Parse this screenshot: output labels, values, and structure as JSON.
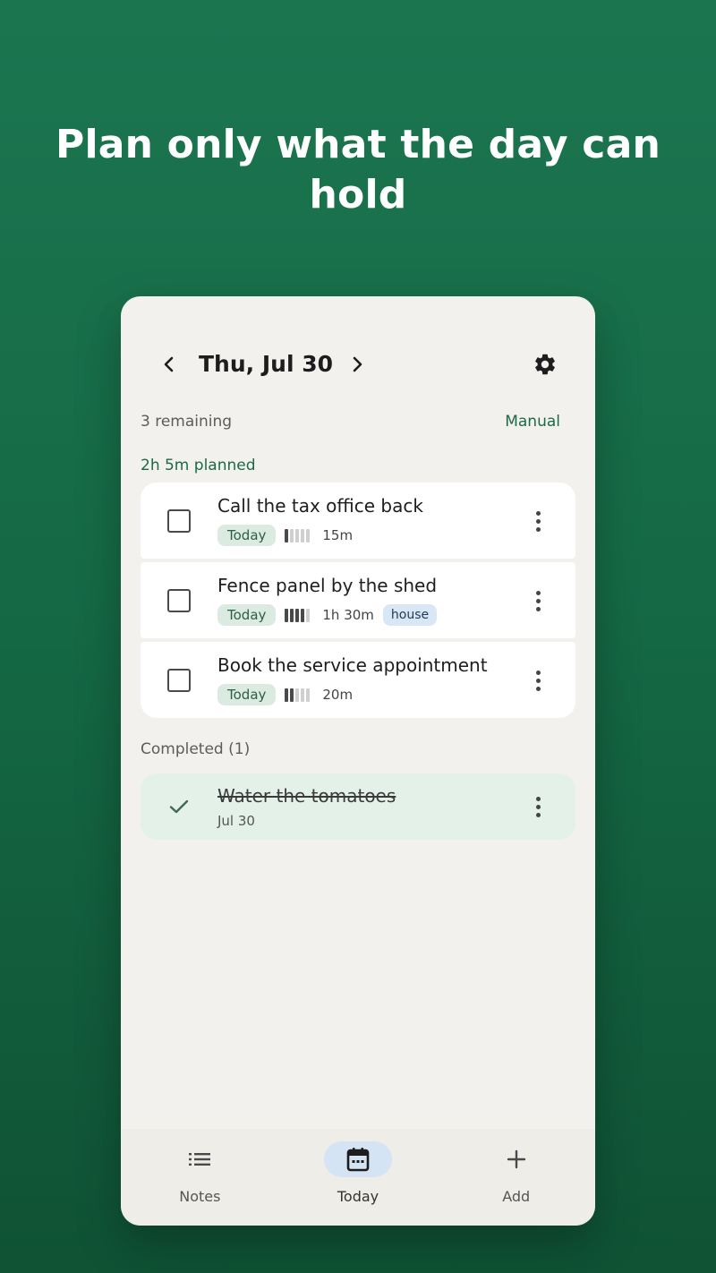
{
  "headline": "Plan only what the day can hold",
  "header": {
    "date": "Thu, Jul 30",
    "prev_icon": "chevron-left-icon",
    "next_icon": "chevron-right-icon",
    "settings_icon": "gear-icon"
  },
  "summary": {
    "remaining": "3 remaining",
    "sort_mode": "Manual",
    "planned": "2h 5m planned"
  },
  "tasks": [
    {
      "title": "Call the tax office back",
      "due": "Today",
      "effort_level": 1,
      "effort_max": 5,
      "duration": "15m",
      "tag": ""
    },
    {
      "title": "Fence panel by the shed",
      "due": "Today",
      "effort_level": 4,
      "effort_max": 5,
      "duration": "1h 30m",
      "tag": "house"
    },
    {
      "title": "Book the service appointment",
      "due": "Today",
      "effort_level": 2,
      "effort_max": 5,
      "duration": "20m",
      "tag": ""
    }
  ],
  "completed": {
    "heading": "Completed (1)",
    "items": [
      {
        "title": "Water the tomatoes",
        "date": "Jul 30"
      }
    ]
  },
  "bottom_nav": [
    {
      "label": "Notes",
      "icon": "list-icon",
      "active": false
    },
    {
      "label": "Today",
      "icon": "calendar-icon",
      "active": true
    },
    {
      "label": "Add",
      "icon": "plus-icon",
      "active": false
    }
  ],
  "colors": {
    "background": "#1b7650",
    "accent": "#1a6b45",
    "today_chip": "#dcebe2",
    "tag_chip": "#d8e6f5",
    "completed_bg": "#e3f1e9",
    "nav_active": "#d4e4f5"
  }
}
